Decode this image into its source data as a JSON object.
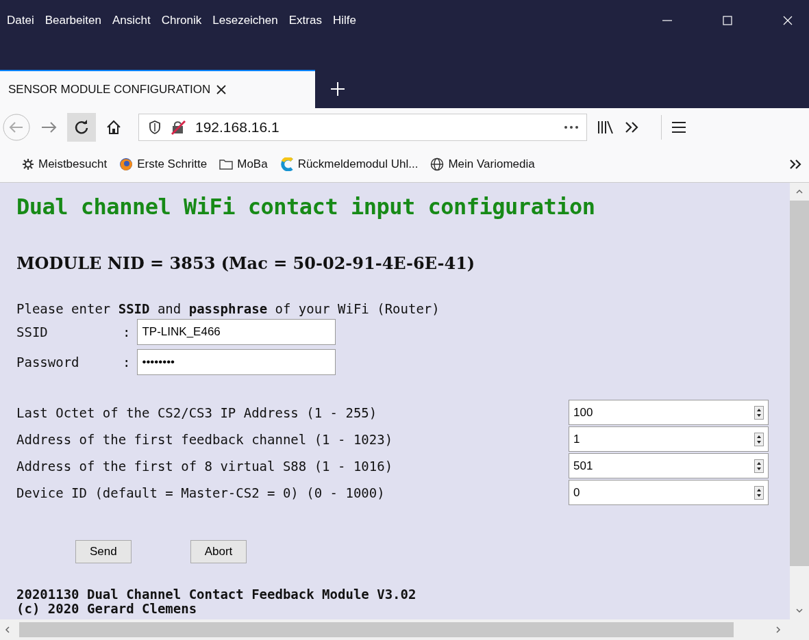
{
  "menu": [
    "Datei",
    "Bearbeiten",
    "Ansicht",
    "Chronik",
    "Lesezeichen",
    "Extras",
    "Hilfe"
  ],
  "tab": {
    "title": "SENSOR MODULE CONFIGURATION",
    "selected": true
  },
  "address_bar": {
    "url": "192.168.16.1"
  },
  "bookmarks": [
    {
      "label": "Meistbesucht",
      "kind": "gear"
    },
    {
      "label": "Erste Schritte",
      "kind": "firefox"
    },
    {
      "label": "MoBa",
      "kind": "folder"
    },
    {
      "label": "Rückmeldemodul Uhl...",
      "kind": "c"
    },
    {
      "label": "Mein Variomedia",
      "kind": "globe"
    }
  ],
  "page": {
    "heading": "Dual channel WiFi contact input configuration",
    "module_line": "MODULE NID = 3853 (Mac = 50-02-91-4E-6E-41)",
    "intro": "Please enter **SSID** and **passphrase** of your WiFi (Router)",
    "credentials": [
      {
        "label": "SSID",
        "separator": ":",
        "value": "TP-LINK_E466"
      },
      {
        "label": "Password",
        "separator": ":",
        "value": "••••••••"
      }
    ],
    "settings": [
      {
        "label": "Last Octet of the CS2/CS3 IP Address (1 - 255)",
        "value": "100"
      },
      {
        "label": "Address of the first feedback channel (1 - 1023)",
        "value": "1"
      },
      {
        "label": "Address of the first of 8 virtual S88 (1 - 1016)",
        "value": "501"
      },
      {
        "label": "Device ID (default = Master-CS2 = 0) (0 - 1000)",
        "value": "0"
      }
    ],
    "buttons": [
      "Send",
      "Abort"
    ],
    "footer": [
      "20201130 Dual Channel Contact Feedback Module V3.02",
      "(c) 2020 Gerard Clemens"
    ]
  }
}
